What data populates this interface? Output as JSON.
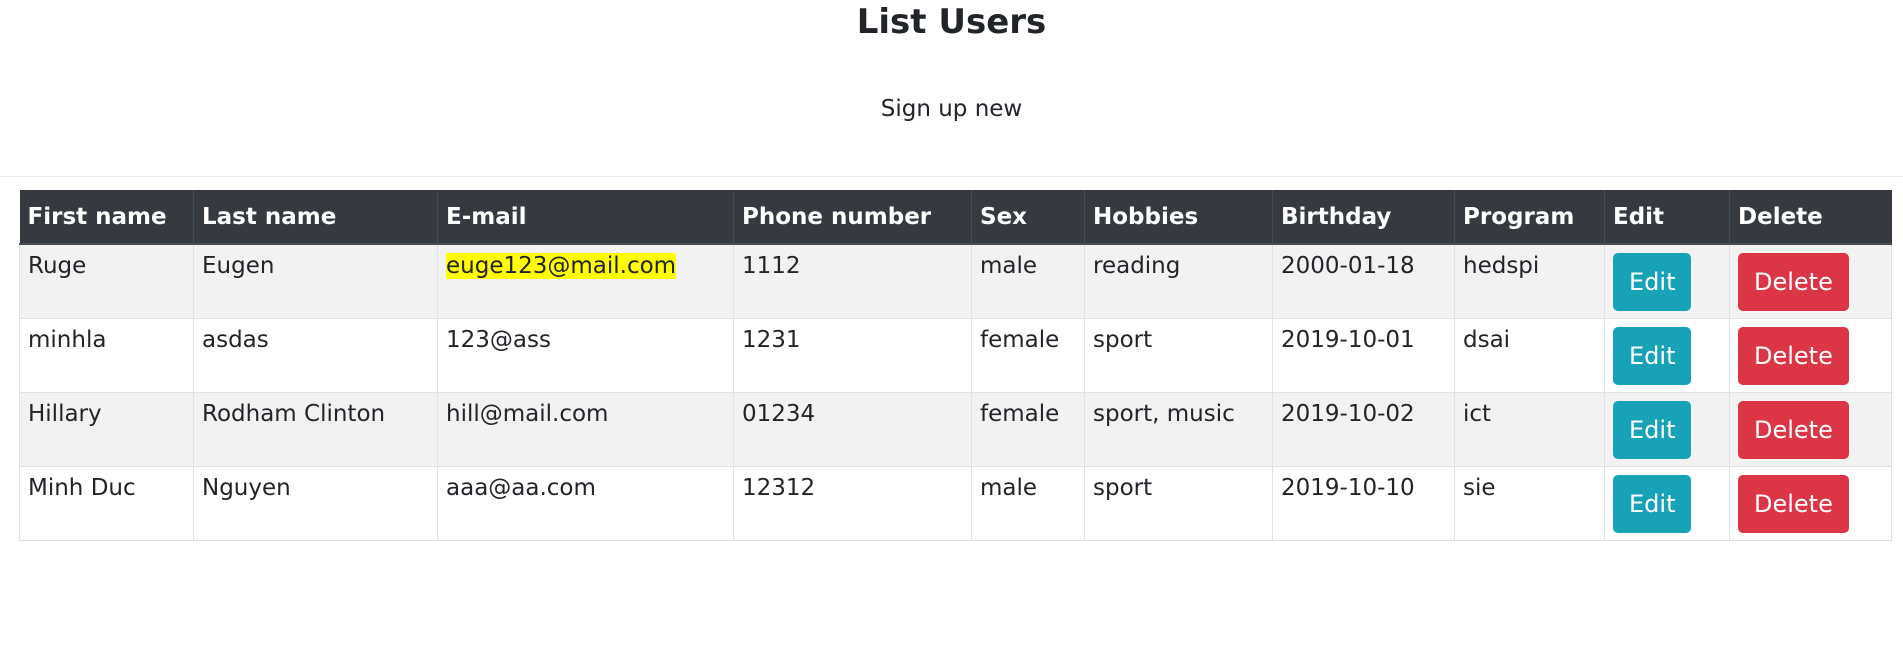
{
  "page": {
    "title": "List Users",
    "signup_link": "Sign up new"
  },
  "table": {
    "columns": [
      "First name",
      "Last name",
      "E-mail",
      "Phone number",
      "Sex",
      "Hobbies",
      "Birthday",
      "Program",
      "Edit",
      "Delete"
    ],
    "rows": [
      {
        "first": "Ruge",
        "last": "Eugen",
        "email": "euge123@mail.com",
        "phone": "1112",
        "sex": "male",
        "hobbies": "reading",
        "birthday": "2000-01-18",
        "program": "hedspi",
        "edit": "Edit",
        "delete": "Delete",
        "email_highlighted": true
      },
      {
        "first": "minhla",
        "last": "asdas",
        "email": "123@ass",
        "phone": "1231",
        "sex": "female",
        "hobbies": "sport",
        "birthday": "2019-10-01",
        "program": "dsai",
        "edit": "Edit",
        "delete": "Delete"
      },
      {
        "first": "Hillary",
        "last": "Rodham Clinton",
        "email": "hill@mail.com",
        "phone": "01234",
        "sex": "female",
        "hobbies": "sport, music",
        "birthday": "2019-10-02",
        "program": "ict",
        "edit": "Edit",
        "delete": "Delete"
      },
      {
        "first": "Minh Duc",
        "last": "Nguyen",
        "email": "aaa@aa.com",
        "phone": "12312",
        "sex": "male",
        "hobbies": "sport",
        "birthday": "2019-10-10",
        "program": "sie",
        "edit": "Edit",
        "delete": "Delete"
      }
    ]
  },
  "colors": {
    "header_bg": "#343a40",
    "edit_button": "#17a2b8",
    "delete_button": "#dc3545",
    "highlight": "#ffff00",
    "stripe": "#f2f2f2"
  }
}
